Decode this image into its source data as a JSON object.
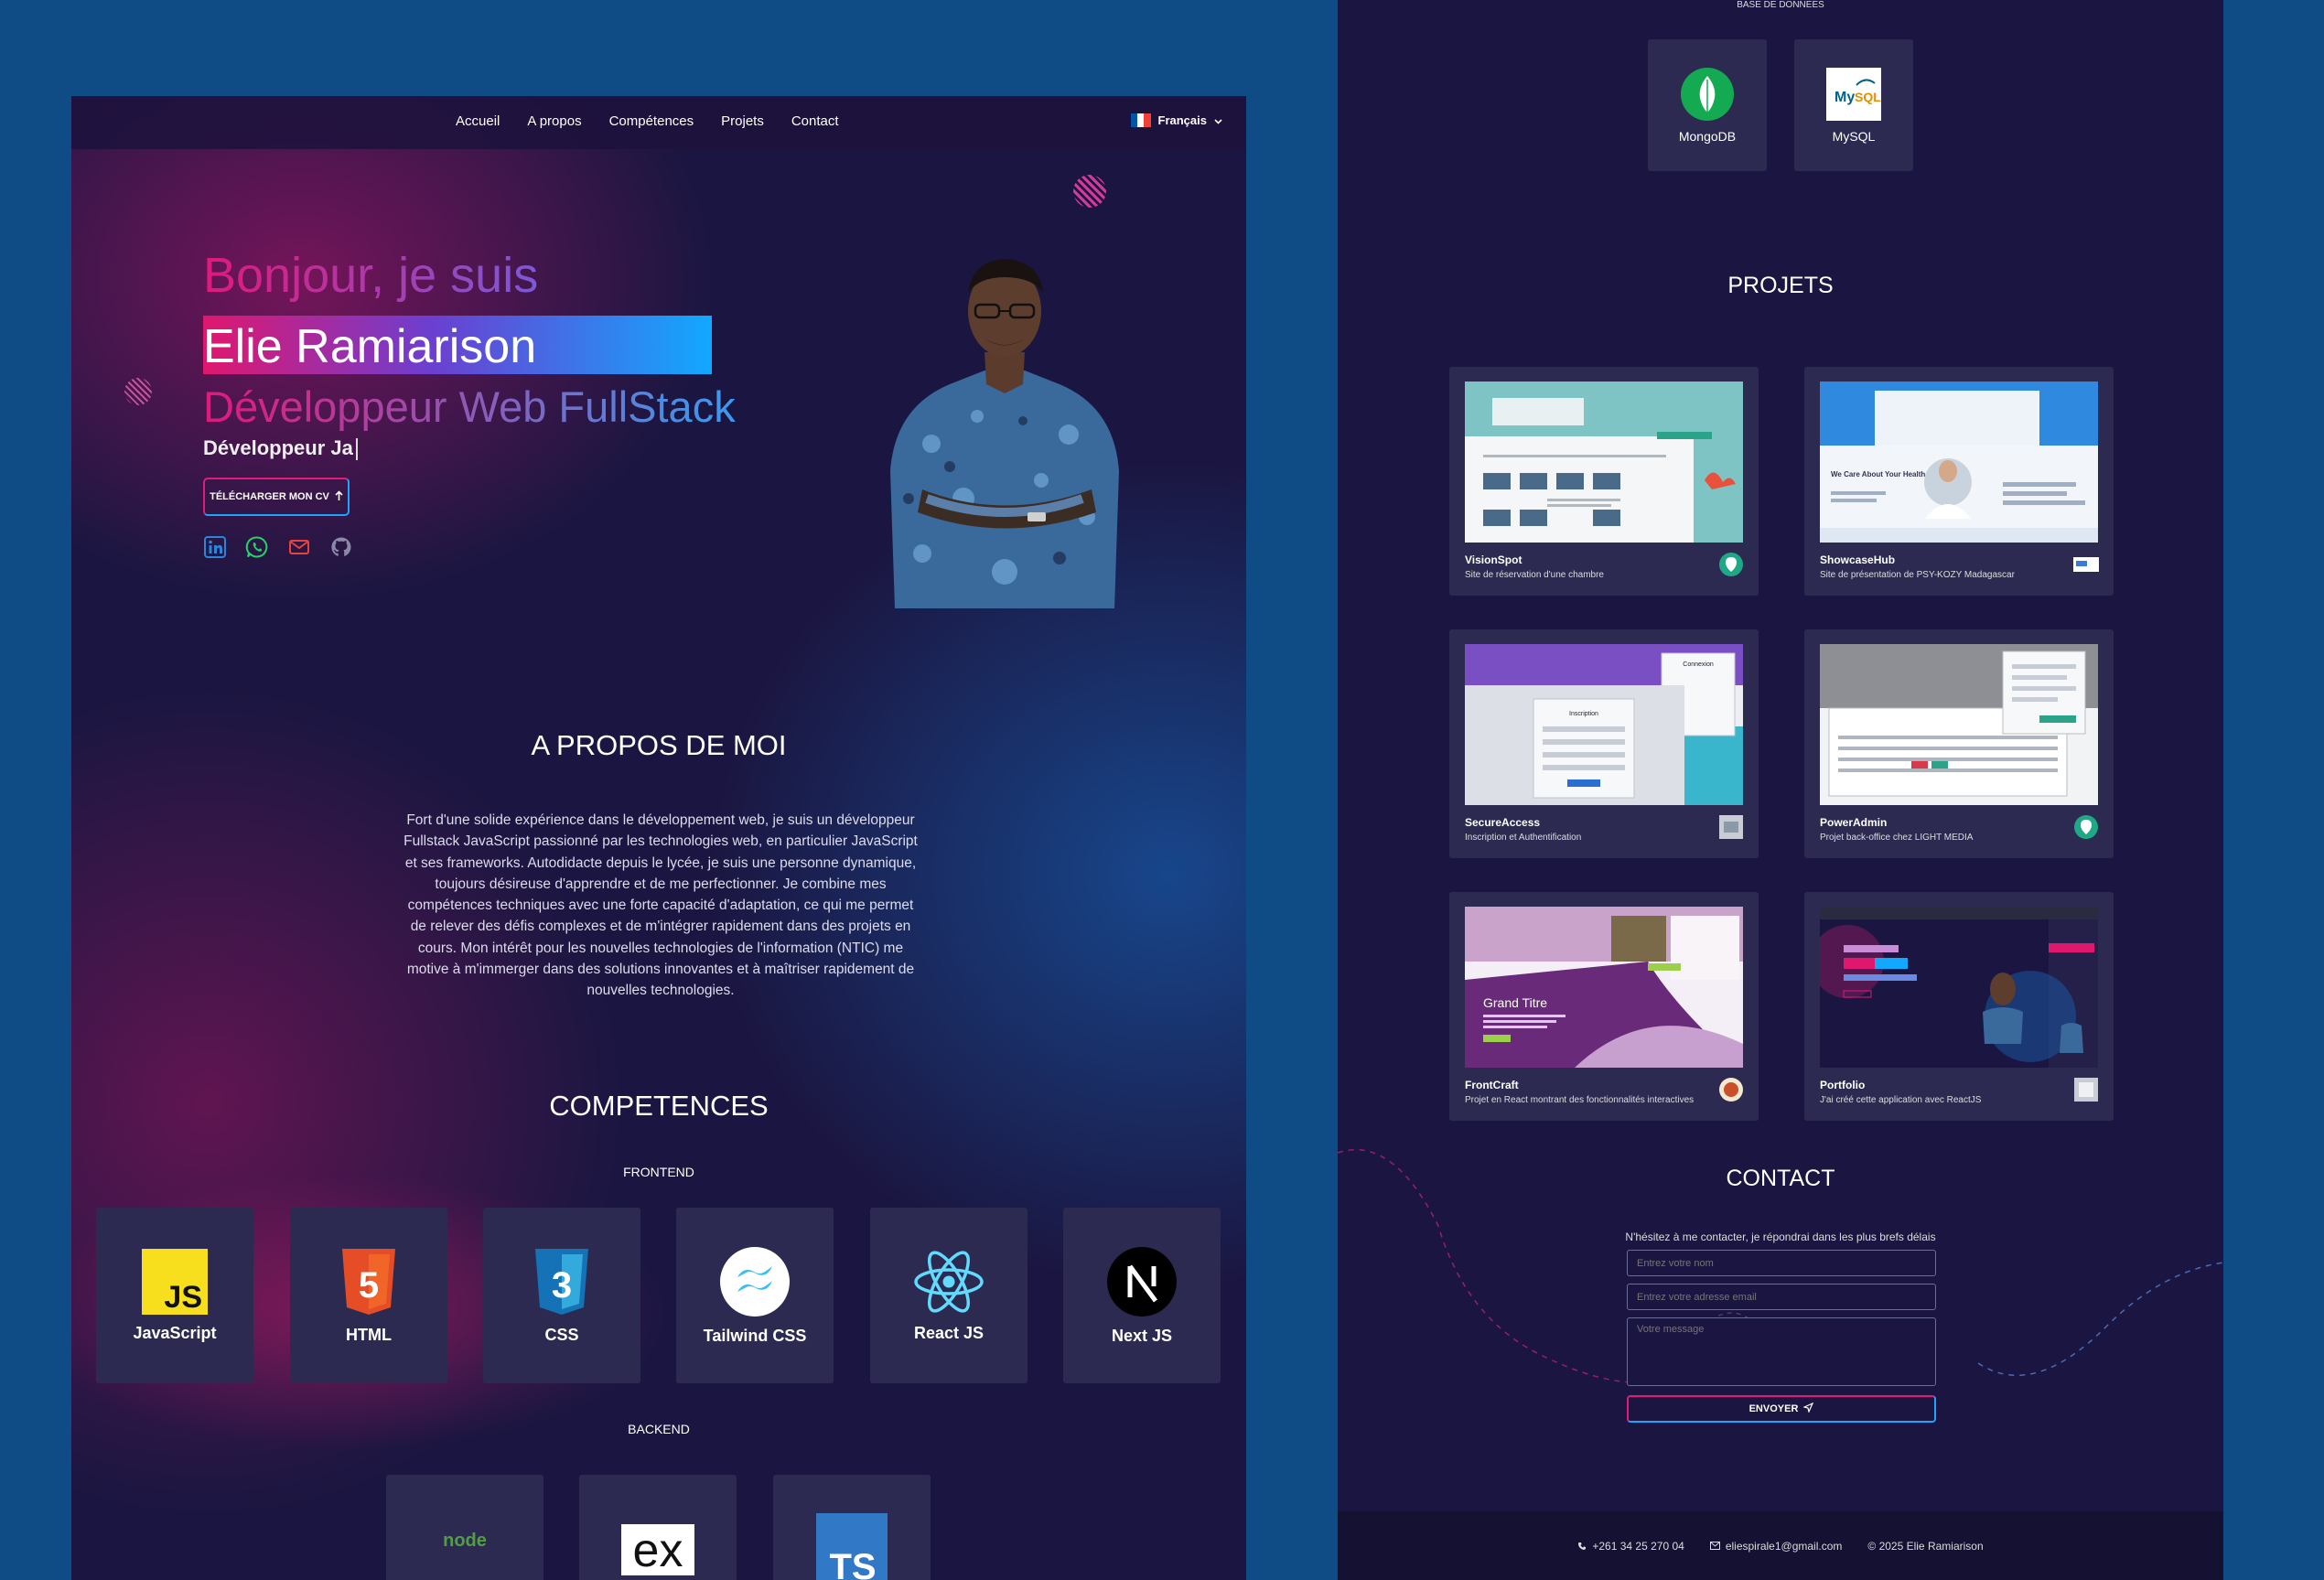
{
  "nav": {
    "links": [
      "Accueil",
      "A propos",
      "Compétences",
      "Projets",
      "Contact"
    ],
    "language": "Français",
    "flag_colors": [
      "#0055A4",
      "#FFFFFF",
      "#EF4135"
    ]
  },
  "hero": {
    "greeting": "Bonjour, je suis",
    "name": "Elie Ramiarison",
    "role": "Développeur Web FullStack",
    "typed_text": "Développeur Ja",
    "cv_button": "TÉLÉCHARGER MON CV",
    "cv_icon": "download-arrow-icon",
    "socials": [
      "linkedin-icon",
      "whatsapp-icon",
      "mail-icon",
      "github-icon"
    ]
  },
  "about": {
    "title": "A PROPOS DE MOI",
    "lines": [
      "Fort d'une solide expérience dans le développement web, je suis un développeur",
      "Fullstack JavaScript passionné par les technologies web, en particulier JavaScript",
      "et ses frameworks. Autodidacte depuis le lycée, je suis une personne dynamique,",
      "toujours désireuse d'apprendre et de me perfectionner. Je combine mes",
      "compétences techniques avec une forte capacité d'adaptation, ce qui me permet",
      "de relever des défis complexes et de m'intégrer rapidement dans des projets en",
      "cours. Mon intérêt pour les nouvelles technologies de l'information (NTIC) me",
      "motive à m'immerger dans des solutions innovantes et à maîtriser rapidement de",
      "nouvelles technologies."
    ]
  },
  "skills": {
    "title": "COMPETENCES",
    "frontend_label": "FRONTEND",
    "frontend": [
      "JavaScript",
      "HTML",
      "CSS",
      "Tailwind CSS",
      "React JS",
      "Next JS"
    ],
    "backend_label": "BACKEND",
    "backend_logos": [
      "node",
      "ex",
      "TS"
    ],
    "database_label": "BASE DE DONNEES",
    "databases": [
      "MongoDB",
      "MySQL"
    ]
  },
  "projects": {
    "title": "PROJETS",
    "items": [
      {
        "name": "VisionSpot",
        "desc": "Site de réservation d'une chambre"
      },
      {
        "name": "ShowcaseHub",
        "desc": "Site de présentation de PSY-KOZY Madagascar"
      },
      {
        "name": "SecureAccess",
        "desc": "Inscription et Authentification"
      },
      {
        "name": "PowerAdmin",
        "desc": "Projet back-office chez LIGHT MEDIA"
      },
      {
        "name": "FrontCraft",
        "desc": "Projet en React montrant des fonctionnalités interactives"
      },
      {
        "name": "Portfolio",
        "desc": "J'ai créé cette application avec ReactJS"
      }
    ],
    "shot_texts": {
      "showcase_heading": "We Care About Your Health",
      "secure_login": "Connexion",
      "secure_register": "Inscription",
      "frontcraft_heading": "Grand Titre"
    }
  },
  "contact": {
    "title": "CONTACT",
    "lead": "N'hésitez à me contacter, je répondrai dans les plus brefs délais",
    "name_placeholder": "Entrez votre nom",
    "email_placeholder": "Entrez votre adresse email",
    "message_placeholder": "Votre message",
    "send": "ENVOYER"
  },
  "footer": {
    "phone": "+261 34 25 270 04",
    "email": "eliespirale1@gmail.com",
    "copyright": "© 2025 Elie Ramiarison"
  },
  "colors": {
    "page_bg": "#0f4c86",
    "panel_bg": "#1b1641",
    "card_bg": "#2d2a52",
    "accent_pink": "#e0176e",
    "accent_blue": "#12a8ff"
  }
}
